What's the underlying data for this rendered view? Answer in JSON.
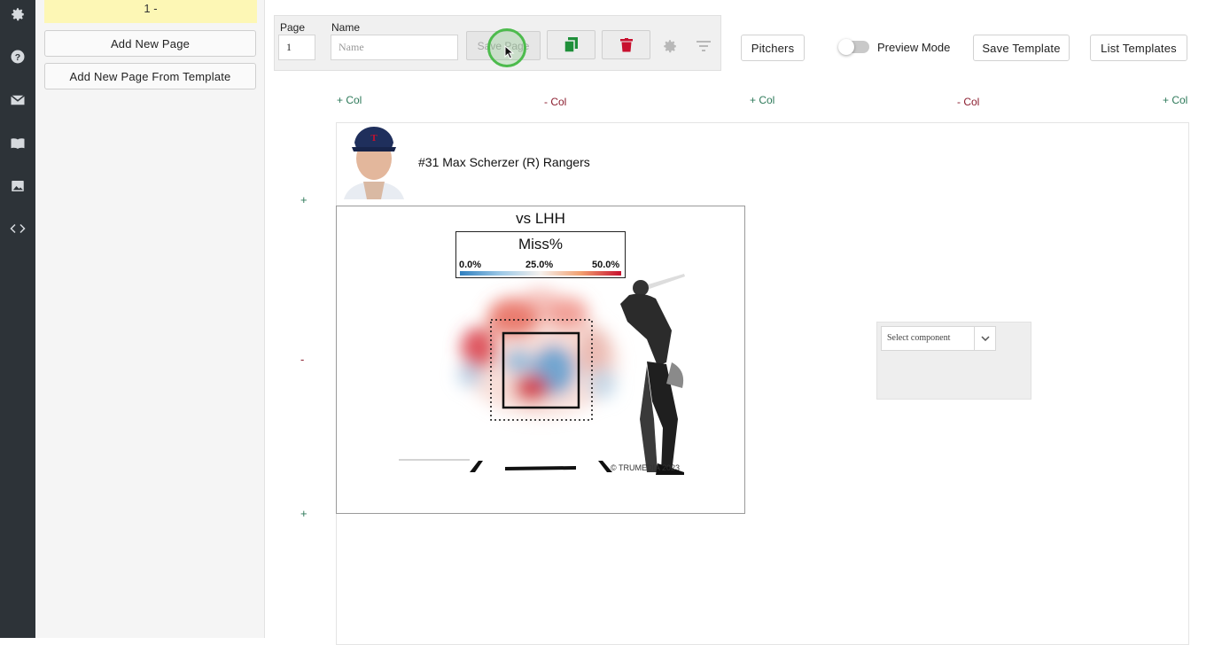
{
  "rail": {
    "icons": [
      "gear-icon",
      "help-icon",
      "mail-icon",
      "book-icon",
      "image-icon",
      "code-icon"
    ]
  },
  "pages_panel": {
    "current_page_tab": "1 -",
    "add_page": "Add New Page",
    "add_from_template": "Add New Page From Template"
  },
  "toolbar": {
    "page_label": "Page",
    "page_value": "1",
    "name_label": "Name",
    "name_placeholder": "Name",
    "save_page": "Save Page",
    "copy_icon": "copy-icon",
    "delete_icon": "trash-icon",
    "settings_icon": "gear-icon",
    "filter_icon": "filter-icon"
  },
  "header_actions": {
    "pitchers": "Pitchers",
    "preview_mode": "Preview Mode",
    "preview_on": false,
    "save_template": "Save Template",
    "list_templates": "List Templates"
  },
  "layout_controls": {
    "col_labels": [
      "+ Col",
      "- Col",
      "+ Col",
      "- Col",
      "+ Col"
    ],
    "row_labels": [
      "+",
      "-",
      "+"
    ]
  },
  "player": {
    "name": "#31 Max Scherzer (R) Rangers"
  },
  "heatmap": {
    "title": "vs LHH",
    "metric": "Miss%",
    "scale_ticks": [
      "0.0%",
      "25.0%",
      "50.0%"
    ],
    "watermark": "© TRUMEDIA 2023",
    "colors": {
      "low": "#2f7fbf",
      "mid": "#f4f1ee",
      "high": "#c8102e"
    }
  },
  "component_selector": {
    "placeholder": "Select component"
  },
  "colors": {
    "rail_bg": "#2d3338",
    "page_tab_bg": "#fdf7b5",
    "add_col": "#2e7a5a",
    "remove_col": "#8b1e2f",
    "copy_green": "#1f8f3a",
    "delete_red": "#c8102e"
  }
}
